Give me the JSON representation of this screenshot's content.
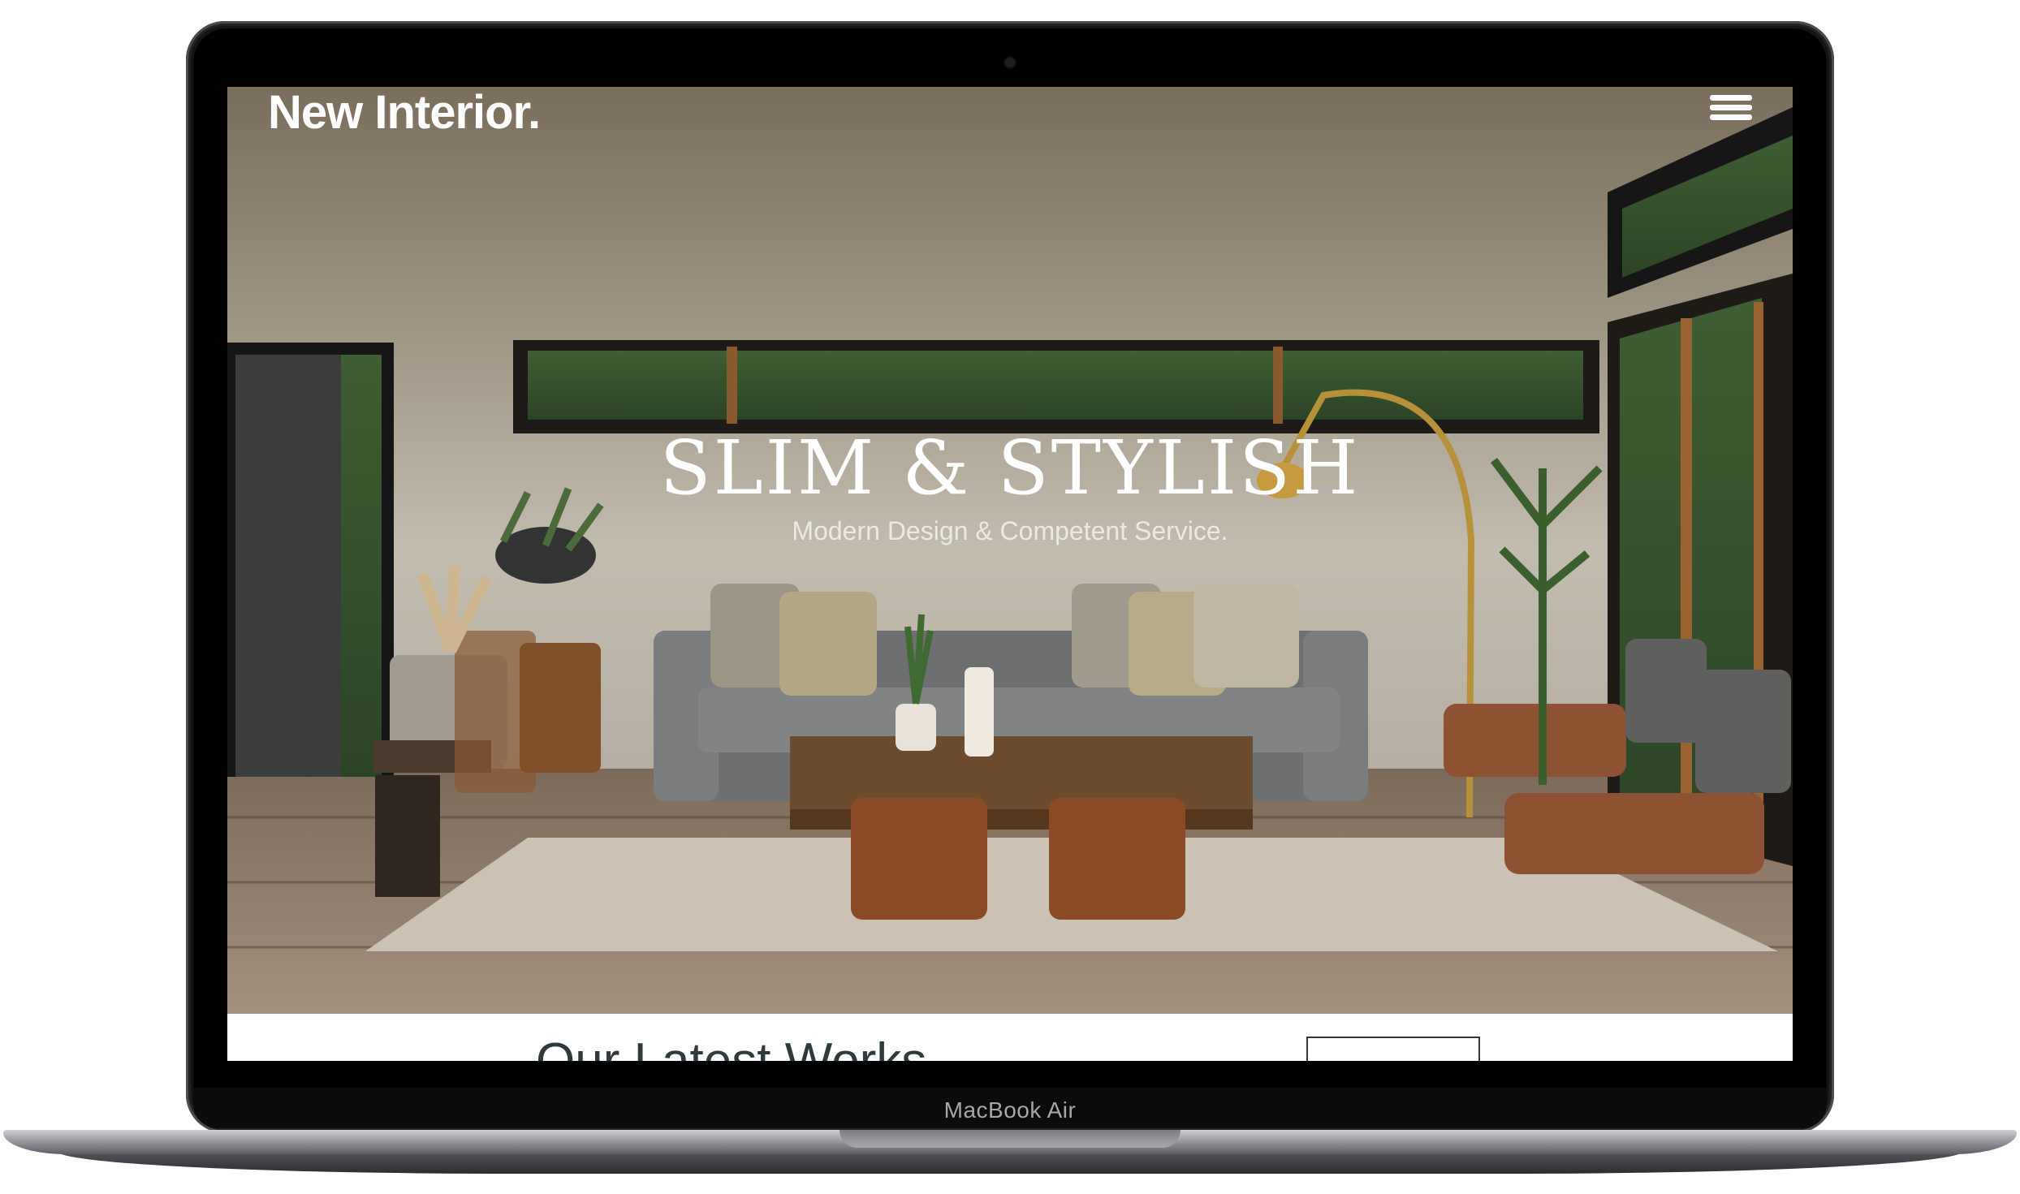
{
  "site": {
    "logo": "New Interior.",
    "hero": {
      "title": "SLIM & STYLISH",
      "subtitle": "Modern Design & Competent Service."
    },
    "section": {
      "title": "Our Latest Works"
    }
  },
  "device": {
    "model_label": "MacBook Air"
  },
  "icons": [
    "hamburger-menu-icon",
    "camera-icon"
  ],
  "colors": {
    "accent_text": "#ffffff",
    "section_title": "#2f3a3e",
    "frame": "#141415"
  }
}
